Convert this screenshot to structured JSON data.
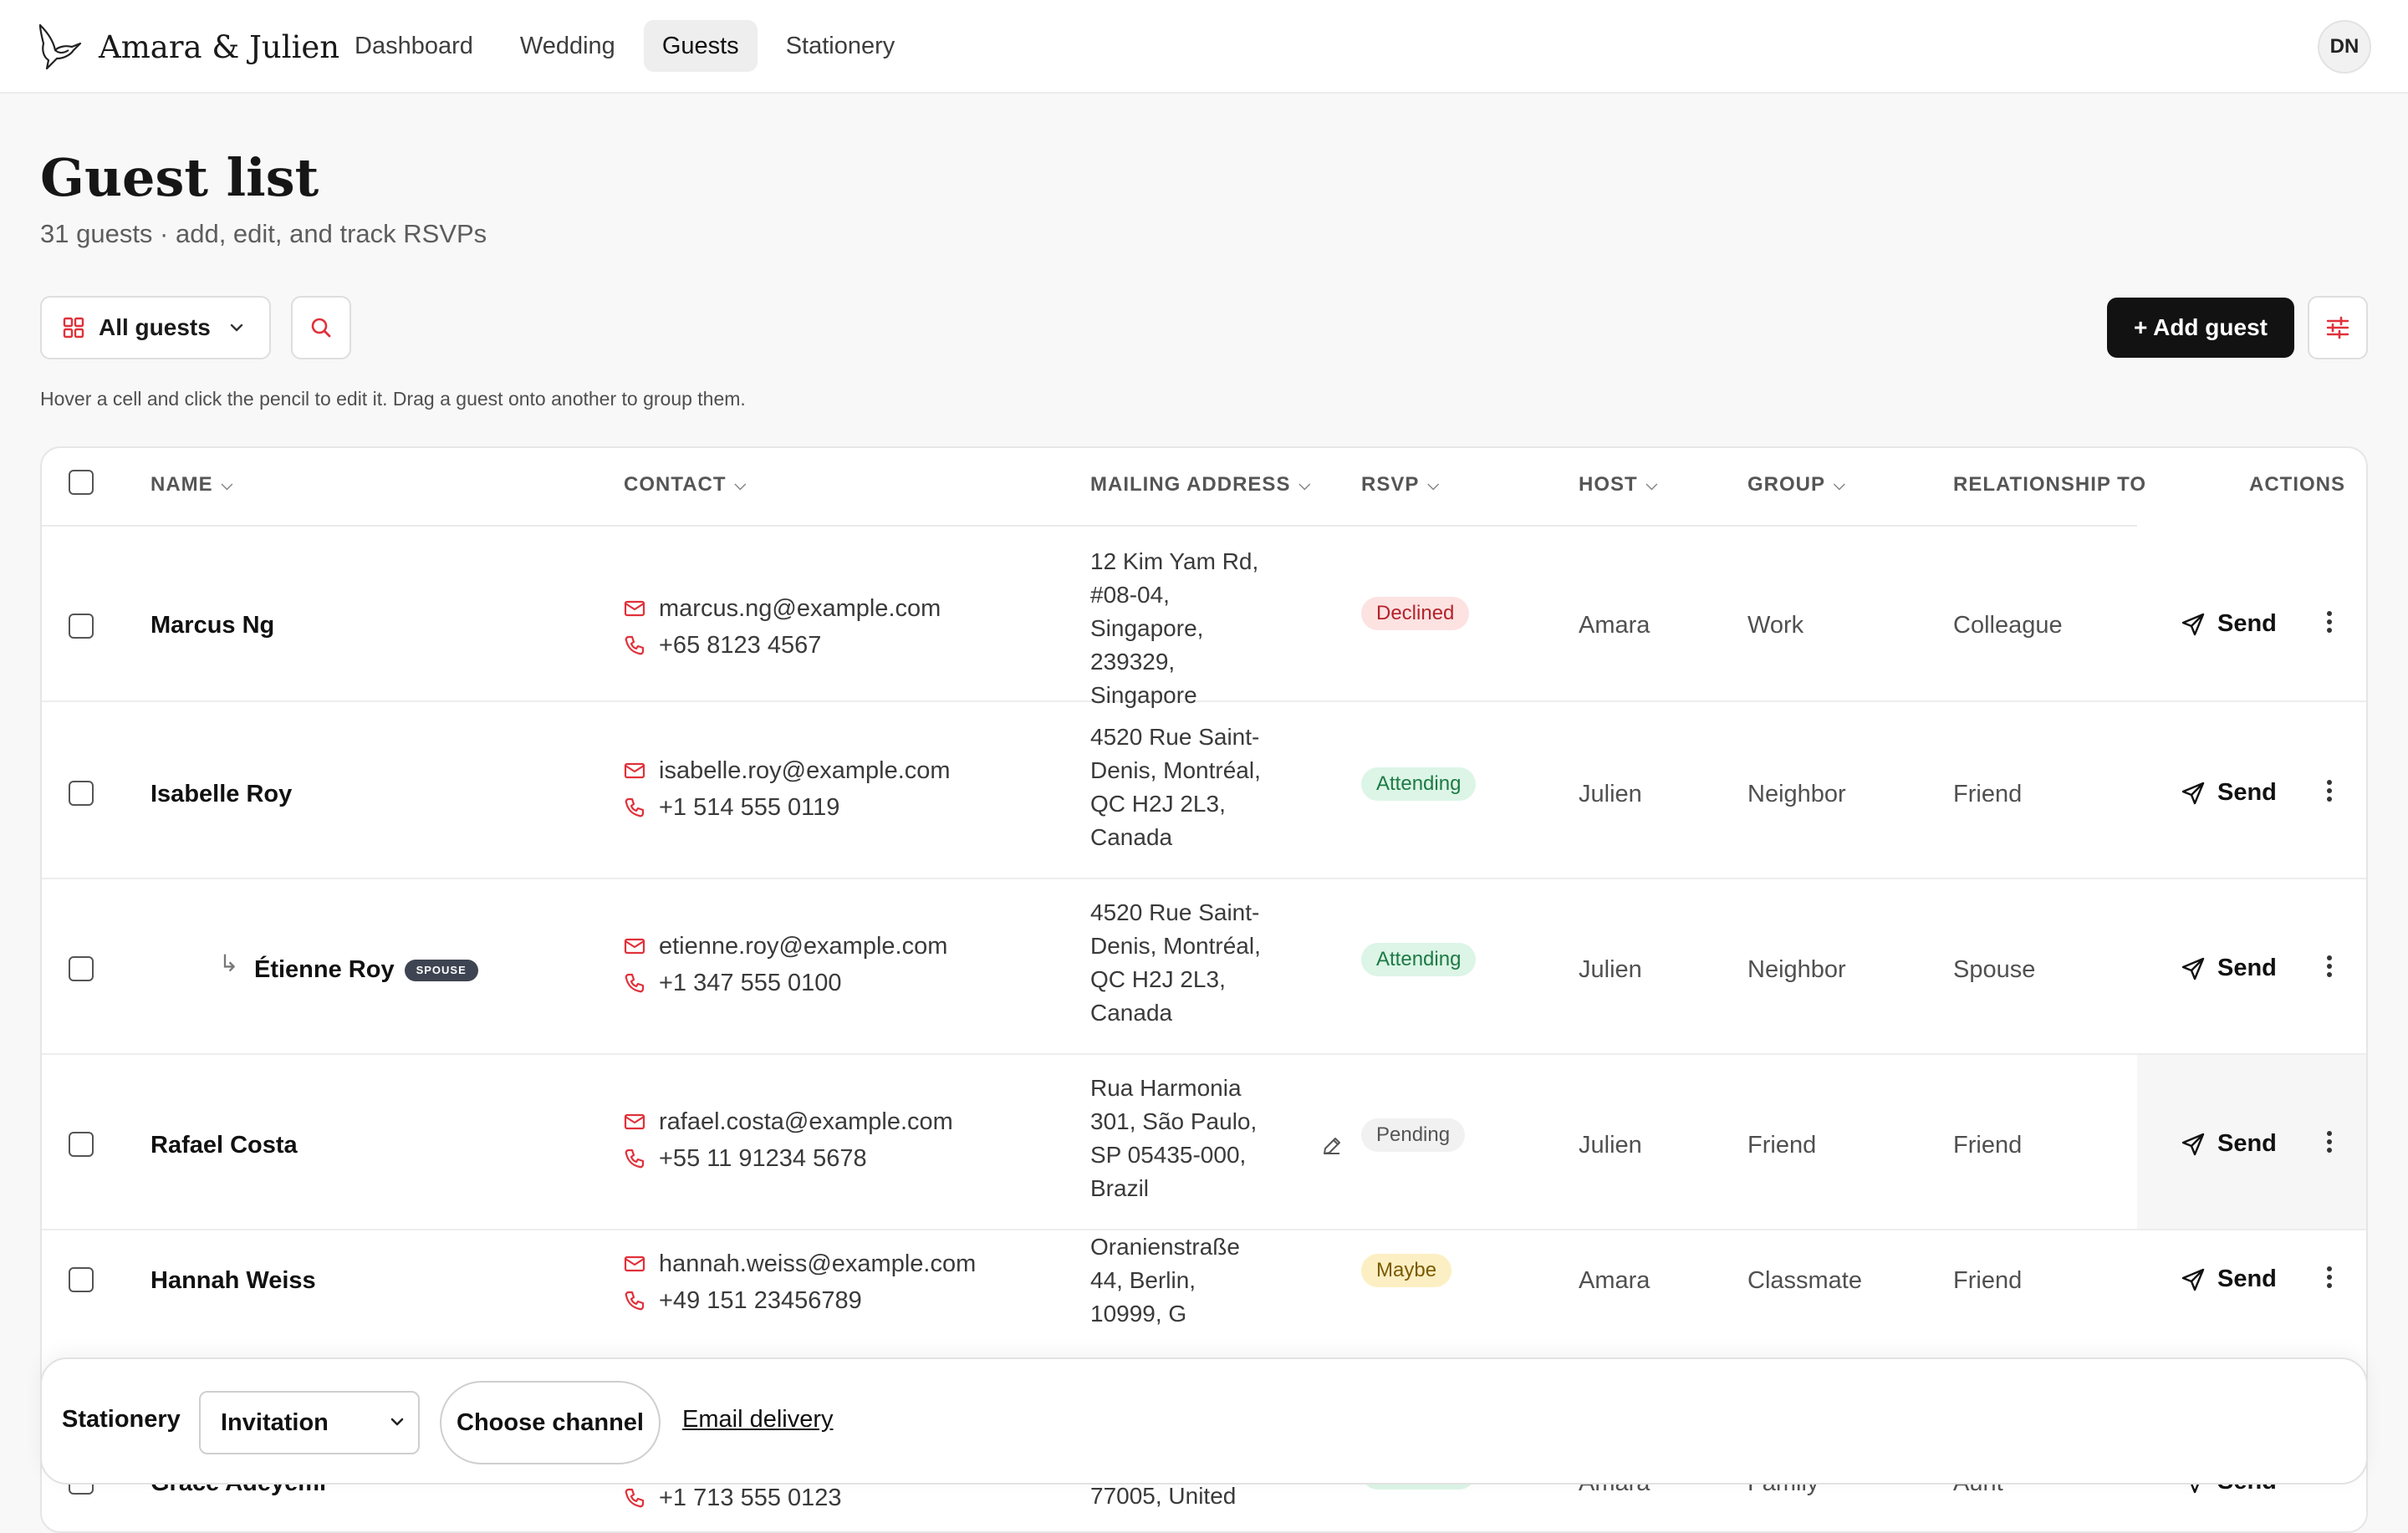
{
  "app": {
    "name": "Amara & Julien",
    "user_initials": "DN"
  },
  "nav": {
    "items": [
      {
        "label": "Dashboard",
        "active": false
      },
      {
        "label": "Wedding",
        "active": false
      },
      {
        "label": "Guests",
        "active": true
      },
      {
        "label": "Stationery",
        "active": false
      }
    ]
  },
  "header": {
    "title": "Guest list",
    "subtitle": "31 guests · add, edit, and track RSVPs"
  },
  "toolbar": {
    "filter_label": "All guests",
    "add_label": "+ Add guest",
    "hint": "Hover a cell and click the pencil to edit it. Drag a guest onto another to group them."
  },
  "table": {
    "columns": {
      "name": "NAME",
      "contact": "CONTACT",
      "address": "MAILING ADDRESS",
      "rsvp": "RSVP",
      "host": "HOST",
      "group": "GROUP",
      "relationship": "RELATIONSHIP TO",
      "actions": "ACTIONS"
    },
    "send_label": "Send",
    "rows": [
      {
        "name": "Marcus Ng",
        "email": "marcus.ng@example.com",
        "phone": "+65 8123 4567",
        "address": [
          "12 Kim Yam Rd,",
          "#08-04,",
          "Singapore,",
          "239329,",
          "Singapore"
        ],
        "rsvp": "Declined",
        "host": "Amara",
        "group": "Work",
        "relationship": "Colleague"
      },
      {
        "name": "Isabelle Roy",
        "email": "isabelle.roy@example.com",
        "phone": "+1 514 555 0119",
        "address": [
          "4520 Rue Saint-",
          "Denis, Montréal,",
          "QC H2J 2L3,",
          "Canada"
        ],
        "rsvp": "Attending",
        "host": "Julien",
        "group": "Neighbor",
        "relationship": "Friend"
      },
      {
        "name": "Étienne Roy",
        "badge": "SPOUSE",
        "email": "etienne.roy@example.com",
        "phone": "+1 347 555 0100",
        "address": [
          "4520 Rue Saint-",
          "Denis, Montréal,",
          "QC H2J 2L3,",
          "Canada"
        ],
        "rsvp": "Attending",
        "host": "Julien",
        "group": "Neighbor",
        "relationship": "Spouse"
      },
      {
        "name": "Rafael Costa",
        "email": "rafael.costa@example.com",
        "phone": "+55 11 91234 5678",
        "address": [
          "Rua Harmonia",
          "301, São Paulo,",
          "SP 05435-000,",
          "Brazil"
        ],
        "rsvp": "Pending",
        "host": "Julien",
        "group": "Friend",
        "relationship": "Friend"
      },
      {
        "name": "Hannah Weiss",
        "email": "hannah.weiss@example.com",
        "phone": "+49 151 23456789",
        "address": [
          "Oranienstraße",
          "44, Berlin,",
          "10999, G"
        ],
        "rsvp": "Maybe",
        "host": "Amara",
        "group": "Classmate",
        "relationship": "Friend"
      },
      {
        "name": "Grace Adeyemi",
        "email": "",
        "phone": "+1 713 555 0123",
        "address": [
          "77005, United"
        ],
        "rsvp": "Attending",
        "host": "Amara",
        "group": "Family",
        "relationship": "Aunt"
      }
    ]
  },
  "bottom_bar": {
    "label": "Stationery",
    "selected": "Invitation",
    "channel_label": "Choose channel",
    "link": "Email delivery"
  },
  "colors": {
    "accent": "#e0313a",
    "primary_button": "#121212"
  }
}
